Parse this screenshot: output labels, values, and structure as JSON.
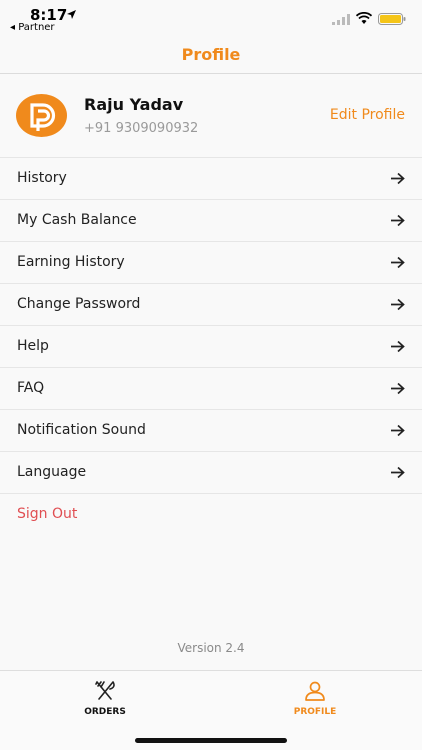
{
  "status_bar": {
    "time": "8:17",
    "back_app": "◂ Partner"
  },
  "nav": {
    "title": "Profile"
  },
  "profile": {
    "name": "Raju Yadav",
    "phone": "+91 9309090932",
    "edit_label": "Edit Profile"
  },
  "menu": {
    "items": [
      {
        "label": "History"
      },
      {
        "label": "My Cash Balance"
      },
      {
        "label": "Earning History"
      },
      {
        "label": "Change Password"
      },
      {
        "label": "Help"
      },
      {
        "label": "FAQ"
      },
      {
        "label": "Notification Sound"
      },
      {
        "label": "Language"
      }
    ],
    "sign_out": "Sign Out"
  },
  "version": "Version 2.4",
  "tabs": [
    {
      "label": "ORDERS",
      "icon": "fork-knife-icon",
      "active": false
    },
    {
      "label": "PROFILE",
      "icon": "person-icon",
      "active": true
    }
  ],
  "colors": {
    "accent": "#f08a1c",
    "danger": "#e04e52",
    "battery": "#f5c518"
  }
}
